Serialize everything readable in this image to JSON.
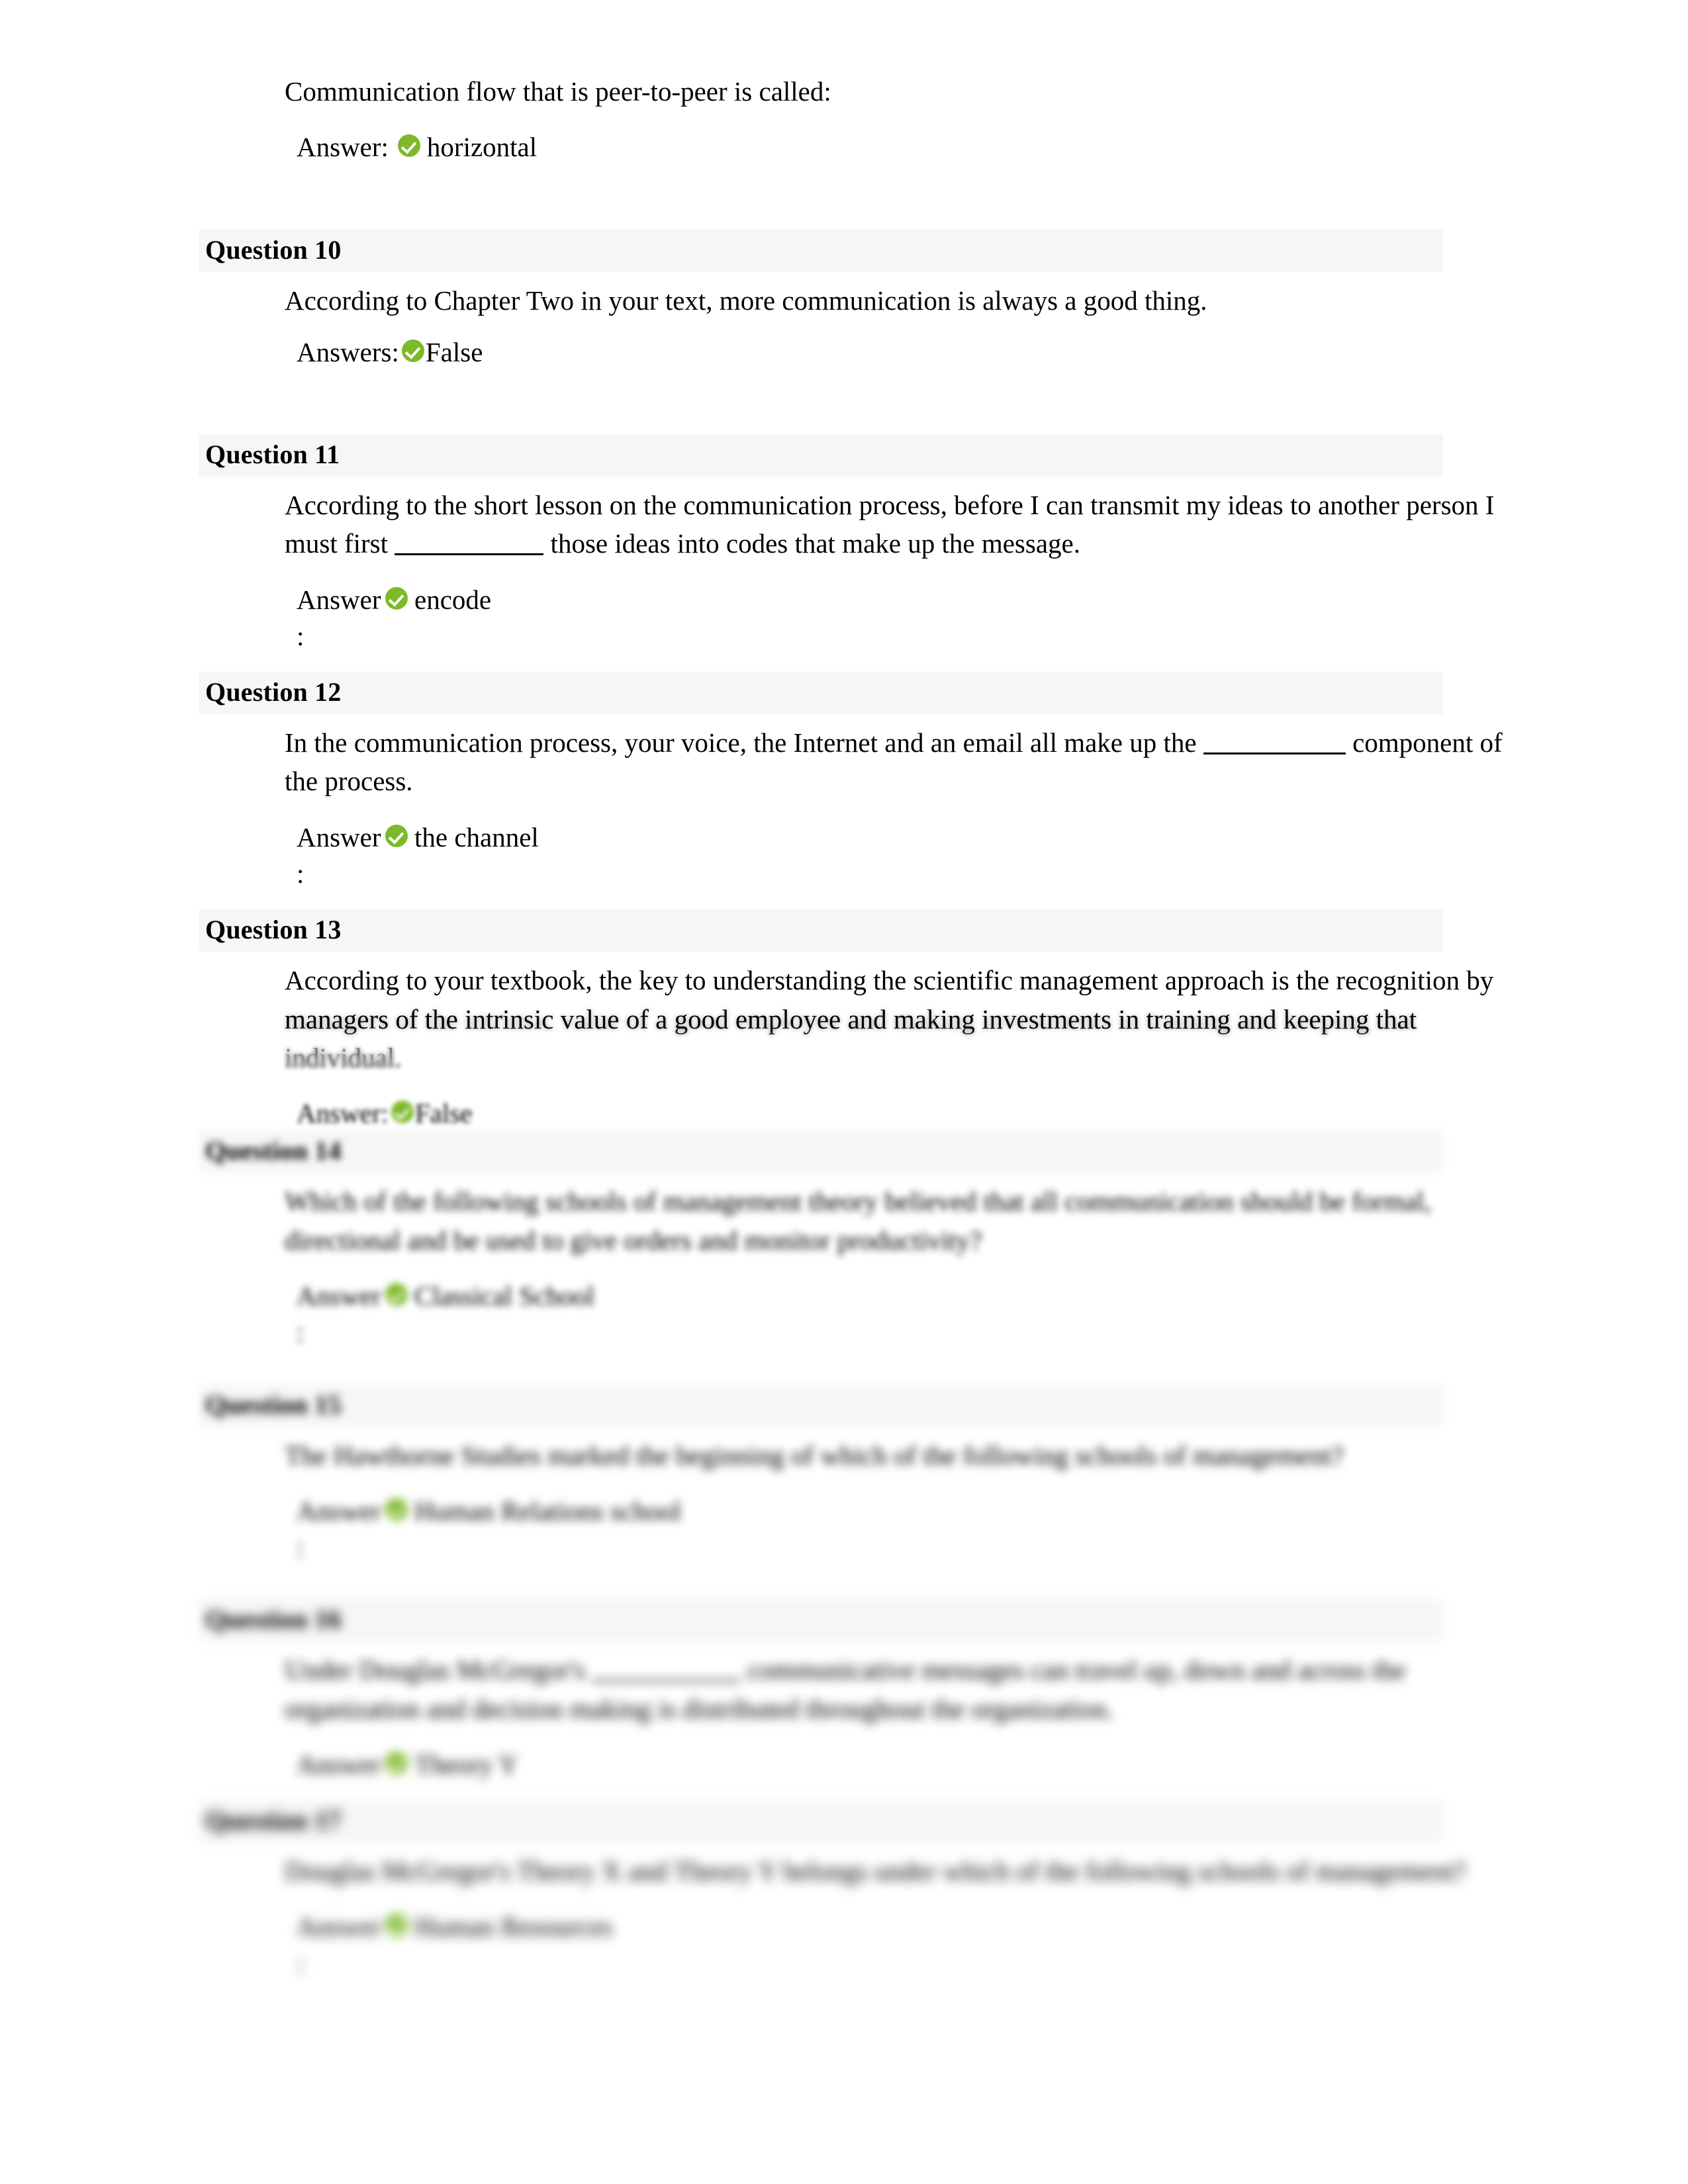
{
  "document": {
    "type": "quiz-review",
    "icon_name": "correct-check-icon",
    "correct_color": "#7db928",
    "header_band_color": "#f6f6f6"
  },
  "labels": {
    "answer_singular": "Answer",
    "answer_singular_colon": "Answer:",
    "answers_plural_colon": "Answers:",
    "colon": ":"
  },
  "questions": [
    {
      "id": "q9",
      "header": "",
      "text_parts": [
        {
          "type": "text",
          "value": "Communication flow that is peer-to-peer is called:"
        }
      ],
      "answer_label": "Answer:",
      "answer_value": "horizontal",
      "answer_layout": "inline"
    },
    {
      "id": "q10",
      "header": "Question 10",
      "text_parts": [
        {
          "type": "text",
          "value": "According to Chapter Two in your text, more communication is always a good thing."
        }
      ],
      "answer_label": "Answers:",
      "answer_value": "False",
      "answer_layout": "inline-tight"
    },
    {
      "id": "q11",
      "header": "Question 11",
      "text_parts": [
        {
          "type": "text",
          "value": "According to the short lesson on the communication process, before I can transmit my ideas to another person I must first "
        },
        {
          "type": "blank"
        },
        {
          "type": "text",
          "value": " those ideas into codes that make up the message."
        }
      ],
      "answer_label": "Answer",
      "answer_value": "encode",
      "answer_layout": "stacked"
    },
    {
      "id": "q12",
      "header": "Question 12",
      "text_parts": [
        {
          "type": "text",
          "value": "In the communication process, your voice, the Internet and an email all make up the "
        },
        {
          "type": "blank"
        },
        {
          "type": "text",
          "value": " component of the process."
        }
      ],
      "answer_label": "Answer",
      "answer_value": "the channel",
      "answer_layout": "stacked"
    },
    {
      "id": "q13",
      "header": "Question 13",
      "text_parts": [
        {
          "type": "text",
          "value": "According to your textbook, the key to understanding the scientific management approach is the recognition by managers of the intrinsic value of a good employee and making investments in training and keeping that individual."
        }
      ],
      "answer_label": "Answer:",
      "answer_value": "False",
      "answer_layout": "inline"
    },
    {
      "id": "q14",
      "header": "Question 14",
      "text_parts": [
        {
          "type": "text",
          "value": "Which of the following schools of management theory believed that all communication should be formal, directional and be used to give orders and monitor productivity?"
        }
      ],
      "answer_label": "Answer",
      "answer_value": "Classical School",
      "answer_layout": "stacked"
    },
    {
      "id": "q15",
      "header": "Question 15",
      "text_parts": [
        {
          "type": "text",
          "value": "The Hawthorne Studies marked the beginning of which of the following schools of management?"
        }
      ],
      "answer_label": "Answer",
      "answer_value": "Human Relations school",
      "answer_layout": "stacked"
    },
    {
      "id": "q16",
      "header": "Question 16",
      "text_parts": [
        {
          "type": "text",
          "value": "Under Douglas McGregor's "
        },
        {
          "type": "blank"
        },
        {
          "type": "text",
          "value": " communicative messages can travel up, down and across the organization and decision making is distributed throughout the organization."
        }
      ],
      "answer_label": "Answer",
      "answer_value": "Theory Y",
      "answer_layout": "stacked"
    },
    {
      "id": "q17",
      "header": "Question 17",
      "text_parts": [
        {
          "type": "text",
          "value": "Douglas McGregor's Theory X and Theory Y belongs under which of the following schools of management?"
        }
      ],
      "answer_label": "Answer",
      "answer_value": "Human Resources",
      "answer_layout": "stacked"
    }
  ]
}
